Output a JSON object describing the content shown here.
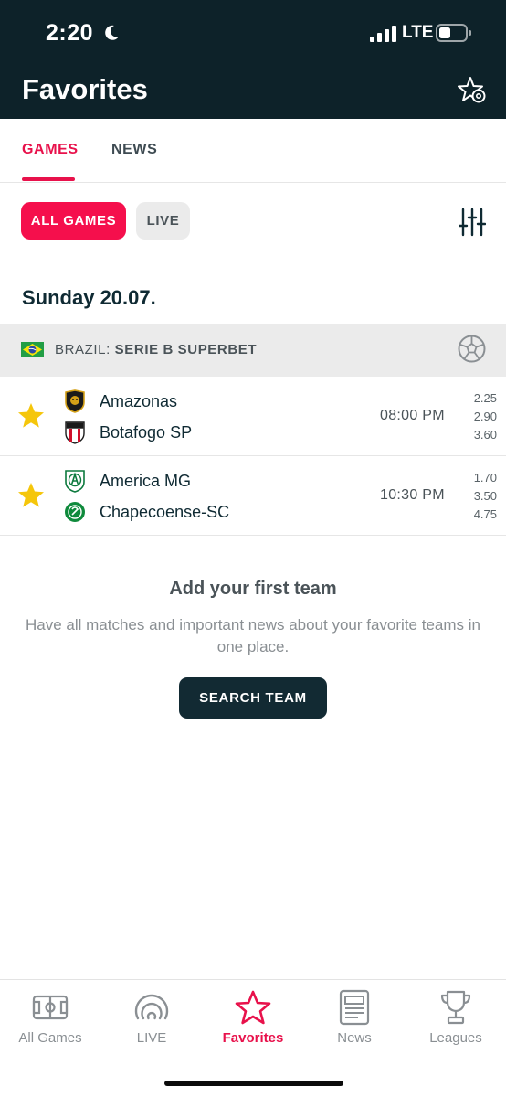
{
  "status_bar": {
    "time": "2:20",
    "network": "LTE"
  },
  "header": {
    "title": "Favorites"
  },
  "tabs": [
    {
      "label": "GAMES",
      "active": true
    },
    {
      "label": "NEWS",
      "active": false
    }
  ],
  "filters": [
    {
      "label": "ALL GAMES",
      "active": true
    },
    {
      "label": "LIVE",
      "active": false
    }
  ],
  "date_heading": "Sunday 20.07.",
  "league": {
    "country": "BRAZIL:",
    "name": "SERIE B SUPERBET"
  },
  "matches": [
    {
      "home": "Amazonas",
      "away": "Botafogo SP",
      "time": "08:00 PM",
      "odds": [
        "2.25",
        "2.90",
        "3.60"
      ],
      "favorite": true
    },
    {
      "home": "America MG",
      "away": "Chapecoense-SC",
      "time": "10:30 PM",
      "odds": [
        "1.70",
        "3.50",
        "4.75"
      ],
      "favorite": true
    }
  ],
  "empty_state": {
    "title": "Add your first team",
    "description": "Have all matches and important news about your favorite teams in one place.",
    "button": "SEARCH TEAM"
  },
  "bottom_nav": [
    {
      "label": "All Games",
      "icon": "pitch-icon",
      "active": false
    },
    {
      "label": "LIVE",
      "icon": "live-icon",
      "active": false
    },
    {
      "label": "Favorites",
      "icon": "star-icon",
      "active": true
    },
    {
      "label": "News",
      "icon": "news-icon",
      "active": false
    },
    {
      "label": "Leagues",
      "icon": "trophy-icon",
      "active": false
    }
  ],
  "colors": {
    "header_bg": "#0d2229",
    "accent": "#e8114b",
    "star": "#f5c60b",
    "button_dark": "#122a33"
  }
}
